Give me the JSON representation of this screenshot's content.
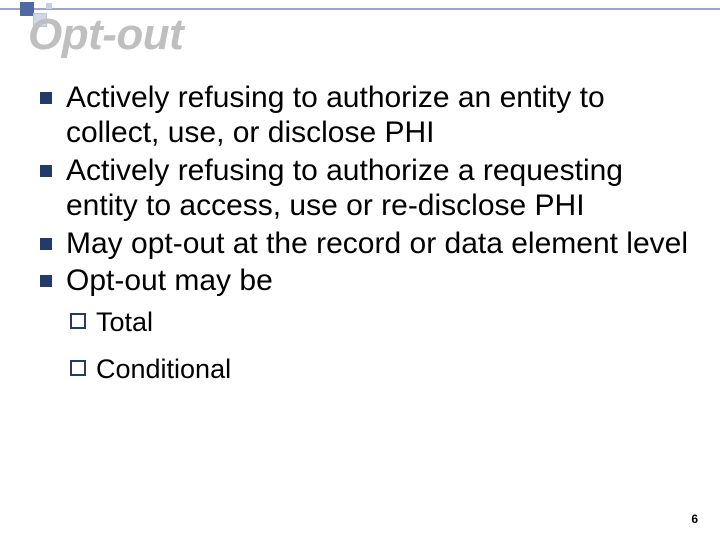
{
  "slide": {
    "title": "Opt-out",
    "bullets": [
      "Actively refusing to authorize an entity to collect, use, or disclose PHI",
      "Actively refusing to authorize a requesting entity to access, use or re-disclose PHI",
      "May opt-out at the record or data element level",
      "Opt-out may be"
    ],
    "sub_bullets": [
      "Total",
      "Conditional"
    ],
    "page_number": "6"
  }
}
